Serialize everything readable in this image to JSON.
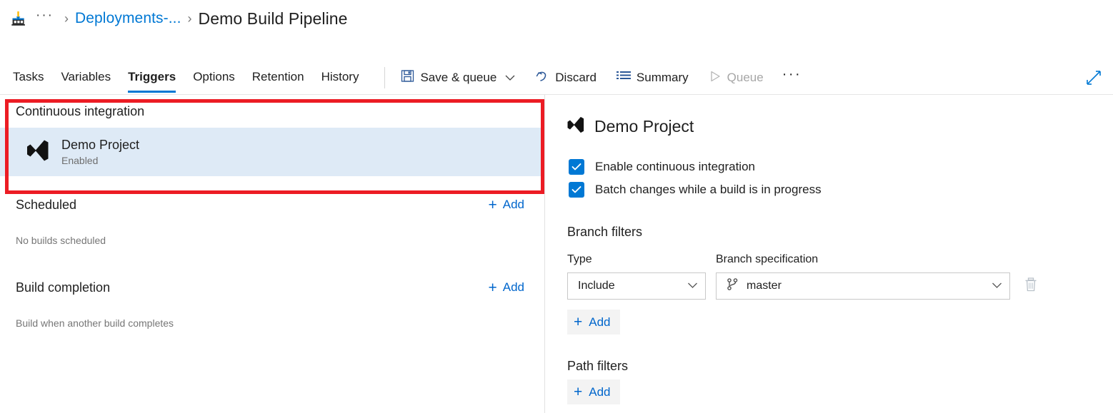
{
  "breadcrumb": {
    "build_icon": "build-factory-icon",
    "ellipsis": "···",
    "separator": "›",
    "project_link": "Deployments-...",
    "current": "Demo Build Pipeline"
  },
  "toolbar": {
    "tabs": [
      {
        "label": "Tasks",
        "active": false
      },
      {
        "label": "Variables",
        "active": false
      },
      {
        "label": "Triggers",
        "active": true
      },
      {
        "label": "Options",
        "active": false
      },
      {
        "label": "Retention",
        "active": false
      },
      {
        "label": "History",
        "active": false
      }
    ],
    "save_queue_label": "Save & queue",
    "discard_label": "Discard",
    "summary_label": "Summary",
    "queue_label": "Queue",
    "overflow_label": "···",
    "expand_icon": "expand-diagonal-icon",
    "accent_color": "#0078d4",
    "disabled_color": "#a6a6a6"
  },
  "left": {
    "continuous_integration": {
      "title": "Continuous integration",
      "trigger": {
        "icon": "visual-studio-icon",
        "name": "Demo Project",
        "status": "Enabled"
      }
    },
    "scheduled": {
      "title": "Scheduled",
      "add_label": "Add",
      "empty_text": "No builds scheduled"
    },
    "build_completion": {
      "title": "Build completion",
      "add_label": "Add",
      "empty_text": "Build when another build completes"
    },
    "highlight_color": "#ec1c24",
    "selected_row_color": "#deeaf6"
  },
  "right": {
    "icon": "visual-studio-icon",
    "title": "Demo Project",
    "checkboxes": [
      {
        "label": "Enable continuous integration",
        "checked": true
      },
      {
        "label": "Batch changes while a build is in progress",
        "checked": true
      }
    ],
    "branch_filters": {
      "title": "Branch filters",
      "type_label": "Type",
      "type_value": "Include",
      "spec_label": "Branch specification",
      "spec_value": "master",
      "spec_icon": "git-branch-icon",
      "delete_icon": "trash-icon",
      "add_label": "Add"
    },
    "path_filters": {
      "title": "Path filters",
      "add_label": "Add"
    }
  }
}
